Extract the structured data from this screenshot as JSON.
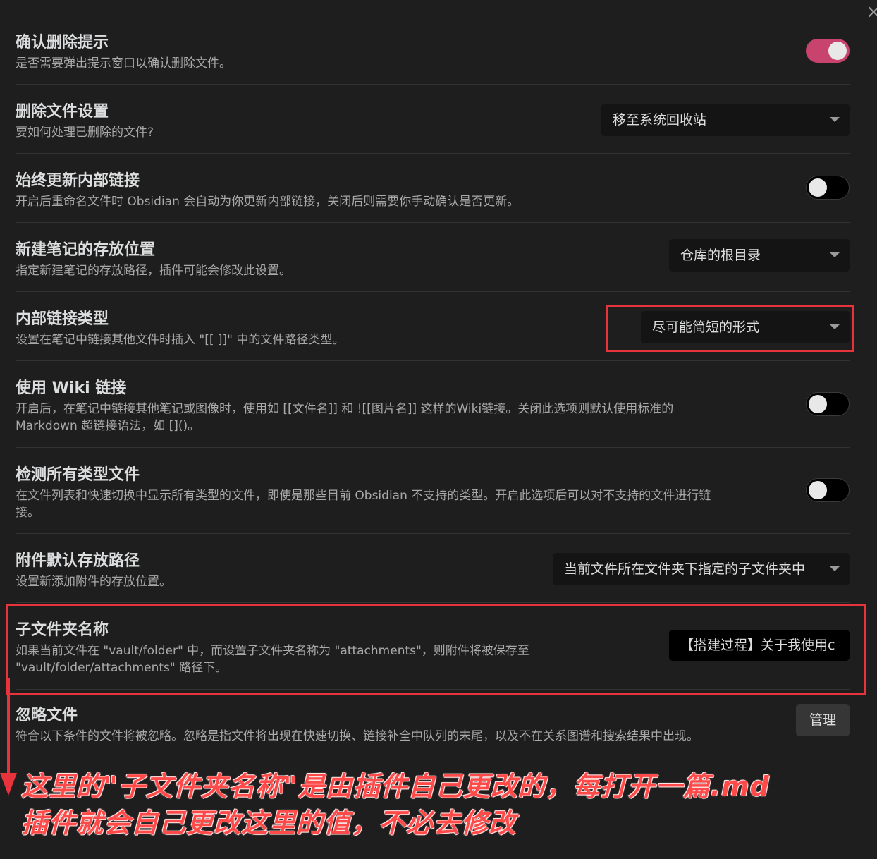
{
  "settings": [
    {
      "title": "确认删除提示",
      "desc": "是否需要弹出提示窗口以确认删除文件。",
      "control": "toggle",
      "on": true
    },
    {
      "title": "删除文件设置",
      "desc": "要如何处理已删除的文件?",
      "control": "dropdown",
      "value": "移至系统回收站"
    },
    {
      "title": "始终更新内部链接",
      "desc": "开启后重命名文件时 Obsidian 会自动为你更新内部链接，关闭后则需要你手动确认是否更新。",
      "control": "toggle",
      "on": false
    },
    {
      "title": "新建笔记的存放位置",
      "desc": "指定新建笔记的存放路径，插件可能会修改此设置。",
      "control": "dropdown",
      "value": "仓库的根目录"
    },
    {
      "title": "内部链接类型",
      "desc": "设置在笔记中链接其他文件时插入 \"[[ ]]\" 中的文件路径类型。",
      "control": "dropdown",
      "value": "尽可能简短的形式"
    },
    {
      "title": "使用 Wiki 链接",
      "desc_line1": "开启后，在笔记中链接其他笔记或图像时，使用如 [[文件名]] 和 ![[图片名]] 这样的Wiki链接。关闭此选项则默认使用标准的",
      "desc_line2": "Markdown 超链接语法，如 []()。",
      "control": "toggle",
      "on": false
    },
    {
      "title": "检测所有类型文件",
      "desc_line1": "在文件列表和快速切换中显示所有类型的文件，即使是那些目前 Obsidian 不支持的类型。开启此选项后可以对不支持的文件进行链",
      "desc_line2": "接。",
      "control": "toggle",
      "on": false
    },
    {
      "title": "附件默认存放路径",
      "desc": "设置新添加附件的存放位置。",
      "control": "dropdown",
      "value": "当前文件所在文件夹下指定的子文件夹中"
    },
    {
      "title": "子文件夹名称",
      "desc_line1": "如果当前文件在 \"vault/folder\" 中，而设置子文件夹名称为 \"attachments\"，则附件将被保存至",
      "desc_line2": "\"vault/folder/attachments\" 路径下。",
      "control": "text",
      "value": "【搭建过程】关于我使用c"
    },
    {
      "title": "忽略文件",
      "desc": "符合以下条件的文件将被忽略。忽略是指文件将出现在快速切换、链接补全中队列的末尾，以及不在关系图谱和搜索结果中出现。",
      "control": "button",
      "value": "管理"
    }
  ],
  "annotation": {
    "line1": "这里的\"子文件夹名称\"是由插件自己更改的，每打开一篇.md",
    "line2": "插件就会自己更改这里的值，不必去修改"
  },
  "colors": {
    "accent": "#c9436f",
    "highlight": "#e8333c",
    "annotation_text": "#ff4a4a"
  },
  "icons": {
    "close": "×",
    "caret": "chevron-down"
  }
}
